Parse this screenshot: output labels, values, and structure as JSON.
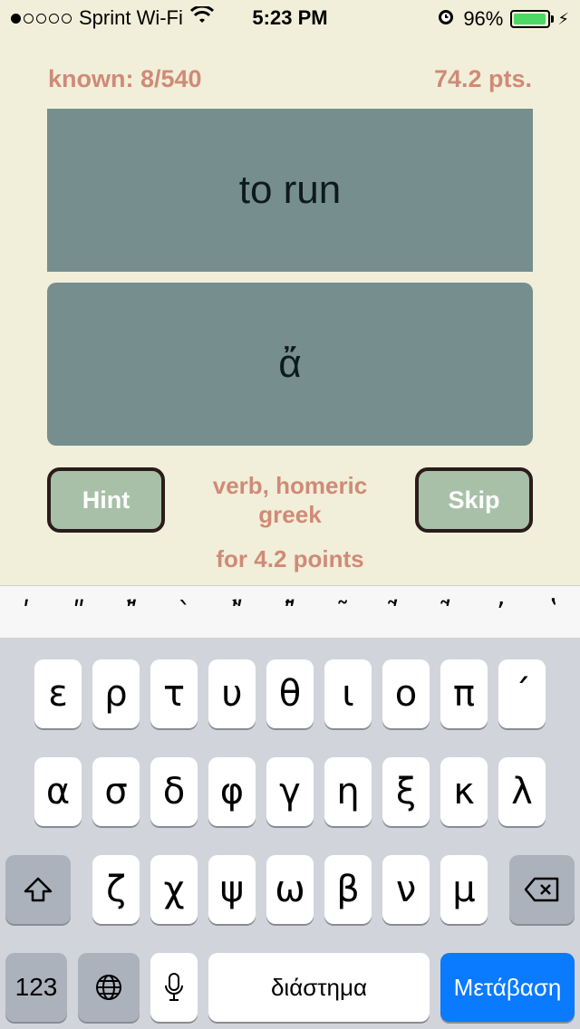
{
  "status_bar": {
    "carrier": "Sprint Wi-Fi",
    "signal_bars_filled": 1,
    "signal_bars_total": 5,
    "time": "5:23 PM",
    "battery_percent": "96%",
    "battery_level": 0.96
  },
  "header": {
    "known": "known: 8/540",
    "points": "74.2 pts."
  },
  "prompt": "to run",
  "answer": "ἄ",
  "hint_label": "Hint",
  "skip_label": "Skip",
  "part_of_speech": "verb, homeric greek",
  "reward": "for 4.2 points",
  "accents": [
    "ʹ",
    "ʺ",
    "ʺ̆",
    "ˋ",
    "ʺ̀",
    "ʺ̄",
    "˜",
    "ʹ͂",
    "ʹ̃",
    "ʼ",
    "ʽ"
  ],
  "keyboard": {
    "row1": [
      "ε",
      "ρ",
      "τ",
      "υ",
      "θ",
      "ι",
      "ο",
      "π",
      "´"
    ],
    "row2": [
      "α",
      "σ",
      "δ",
      "φ",
      "γ",
      "η",
      "ξ",
      "κ",
      "λ"
    ],
    "row3": [
      "ζ",
      "χ",
      "ψ",
      "ω",
      "β",
      "ν",
      "μ"
    ],
    "numbers_label": "123",
    "space_label": "διάστημα",
    "go_label": "Μετάβαση"
  },
  "colors": {
    "background": "#f1efd9",
    "card": "#768e8e",
    "score_text": "#d08a78",
    "button_fill": "#a7c0a7",
    "go_key": "#0a7aff"
  }
}
